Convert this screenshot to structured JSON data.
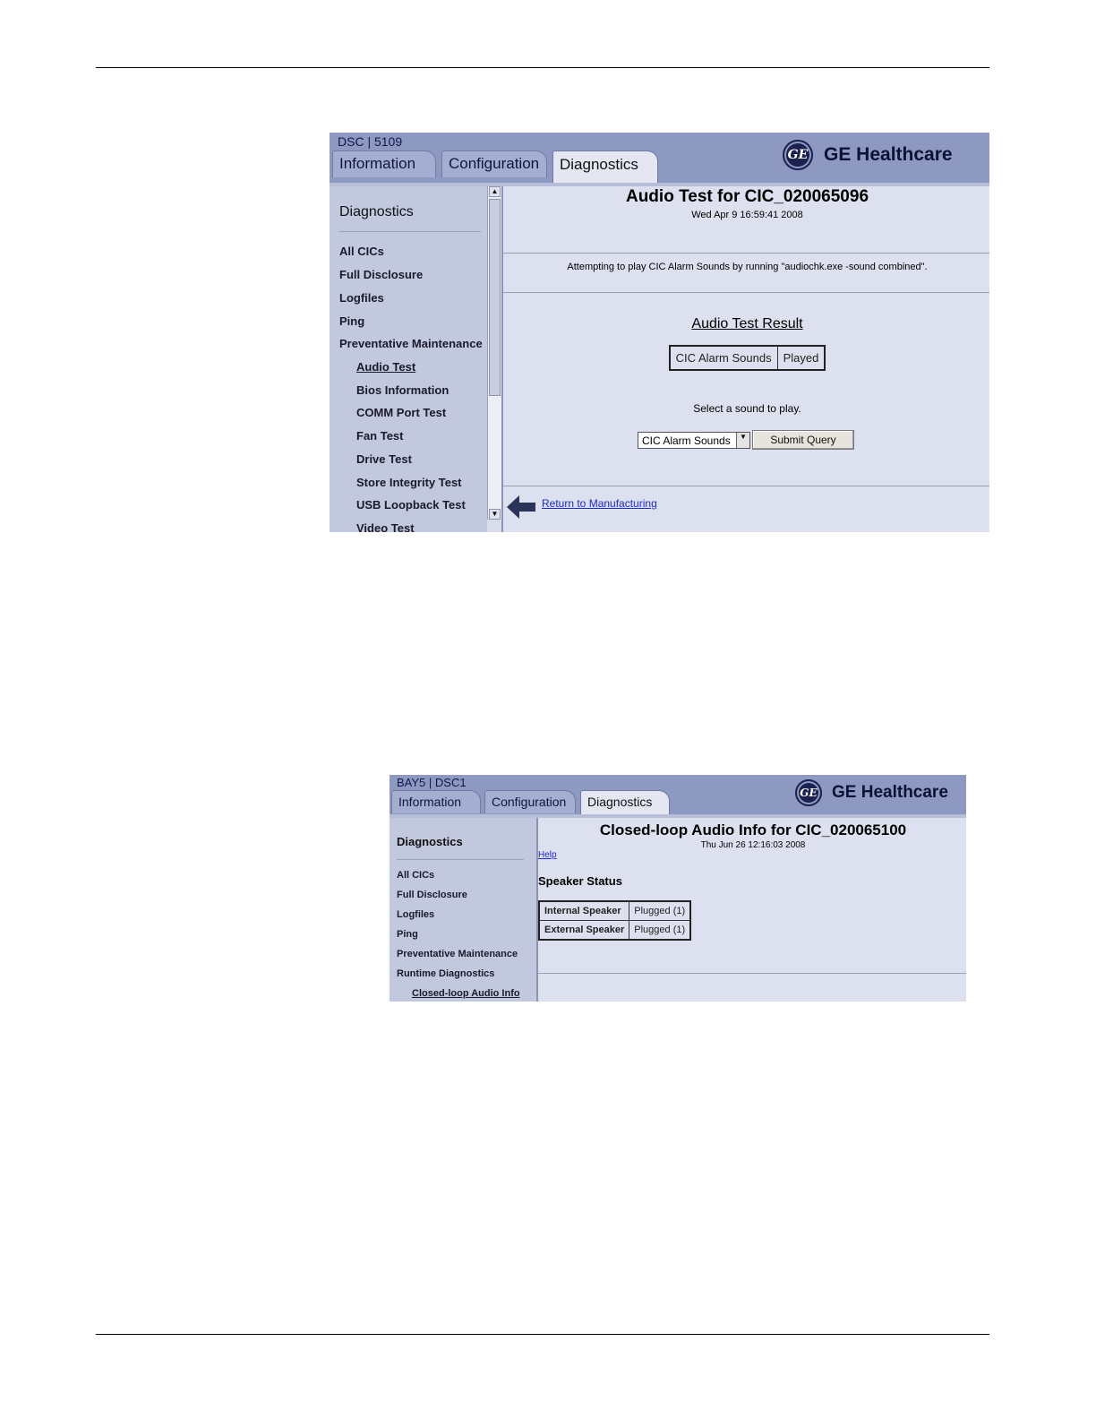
{
  "screen1": {
    "system_label": "DSC | 5109",
    "tabs": [
      {
        "label": "Information"
      },
      {
        "label": "Configuration"
      },
      {
        "label": "Diagnostics"
      }
    ],
    "brand": "GE Healthcare",
    "logo_text": "GE",
    "sidebar": {
      "heading": "Diagnostics",
      "items": [
        {
          "label": "All CICs"
        },
        {
          "label": "Full Disclosure"
        },
        {
          "label": "Logfiles"
        },
        {
          "label": "Ping"
        },
        {
          "label": "Preventative Maintenance"
        },
        {
          "label": "Audio Test"
        },
        {
          "label": "Bios Information"
        },
        {
          "label": "COMM Port Test"
        },
        {
          "label": "Fan Test"
        },
        {
          "label": "Drive Test"
        },
        {
          "label": "Store Integrity Test"
        },
        {
          "label": "USB Loopback Test"
        },
        {
          "label": "Video Test"
        }
      ]
    },
    "main": {
      "title": "Audio Test for CIC_020065096",
      "timestamp": "Wed Apr 9 16:59:41 2008",
      "message": "Attempting to play CIC Alarm Sounds by running \"audiochk.exe -sound combined\".",
      "result_heading": "Audio Test Result",
      "result": {
        "name": "CIC Alarm Sounds",
        "status": "Played"
      },
      "select_prompt": "Select a sound to play.",
      "select_value": "CIC Alarm Sounds",
      "submit_label": "Submit Query",
      "return_link": "Return to Manufacturing"
    }
  },
  "screen2": {
    "system_label": "BAY5 | DSC1",
    "tabs": [
      {
        "label": "Information"
      },
      {
        "label": "Configuration"
      },
      {
        "label": "Diagnostics"
      }
    ],
    "brand": "GE Healthcare",
    "logo_text": "GE",
    "sidebar": {
      "heading": "Diagnostics",
      "items": [
        {
          "label": "All CICs"
        },
        {
          "label": "Full Disclosure"
        },
        {
          "label": "Logfiles"
        },
        {
          "label": "Ping"
        },
        {
          "label": "Preventative Maintenance"
        },
        {
          "label": "Runtime Diagnostics"
        },
        {
          "label": "Closed-loop Audio Info"
        }
      ]
    },
    "main": {
      "title": "Closed-loop Audio Info for CIC_020065100",
      "timestamp": "Thu Jun 26 12:16:03 2008",
      "help_link": "Help",
      "section_heading": "Speaker Status",
      "rows": [
        {
          "name": "Internal Speaker",
          "status": "Plugged (1)"
        },
        {
          "name": "External Speaker",
          "status": "Plugged (1)"
        }
      ]
    }
  }
}
